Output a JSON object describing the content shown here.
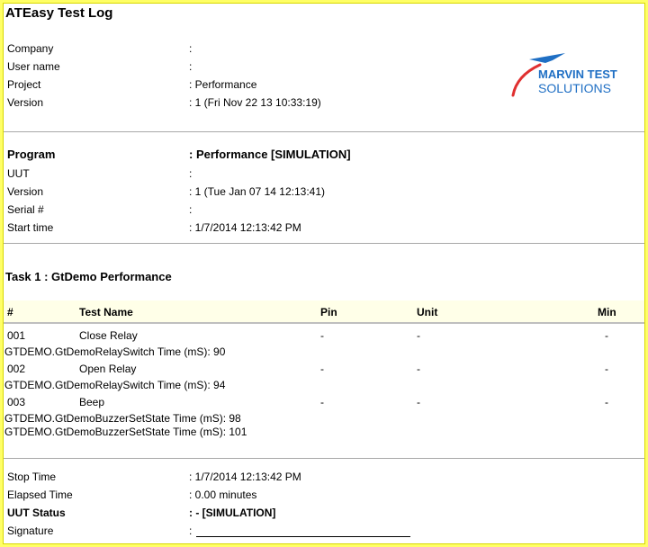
{
  "title": "ATEasy Test Log",
  "logo": {
    "line1": "MARVIN TEST",
    "line2": "SOLUTIONS",
    "colors": {
      "blue": "#1f6fc4",
      "red": "#e03030"
    }
  },
  "header_info": [
    {
      "label": "Company",
      "value": ":"
    },
    {
      "label": "User name",
      "value": ":"
    },
    {
      "label": "Project",
      "value": ": Performance"
    },
    {
      "label": "Version",
      "value": ": 1 (Fri Nov 22 13 10:33:19)"
    }
  ],
  "program": {
    "label": "Program",
    "value": ": Performance [SIMULATION]",
    "fields": [
      {
        "label": "UUT",
        "value": ":"
      },
      {
        "label": "Version",
        "value": ": 1 (Tue Jan 07 14 12:13:41)"
      },
      {
        "label": "Serial #",
        "value": ":"
      },
      {
        "label": "Start time",
        "value": ": 1/7/2014 12:13:42 PM"
      }
    ]
  },
  "task": {
    "title": "Task 1 : GtDemo Performance",
    "columns": [
      "#",
      "Test Name",
      "Pin",
      "Unit",
      "Min"
    ],
    "rows": [
      {
        "num": "001",
        "name": "Close Relay",
        "pin": "-",
        "unit": "-",
        "min": "-",
        "details": [
          "GTDEMO.GtDemoRelaySwitch Time (mS): 90"
        ]
      },
      {
        "num": "002",
        "name": "Open Relay",
        "pin": "-",
        "unit": "-",
        "min": "-",
        "details": [
          "GTDEMO.GtDemoRelaySwitch Time (mS): 94"
        ]
      },
      {
        "num": "003",
        "name": "Beep",
        "pin": "-",
        "unit": "-",
        "min": "-",
        "details": [
          "GTDEMO.GtDemoBuzzerSetState Time (mS): 98",
          "GTDEMO.GtDemoBuzzerSetState Time (mS): 101"
        ]
      }
    ]
  },
  "footer_info": [
    {
      "label": "Stop Time",
      "value": ": 1/7/2014 12:13:42 PM",
      "bold": false
    },
    {
      "label": "Elapsed Time",
      "value": ": 0.00 minutes",
      "bold": false
    },
    {
      "label": "UUT Status",
      "value": ": - [SIMULATION]",
      "bold": true
    },
    {
      "label": "Signature",
      "value": ":",
      "bold": false
    }
  ]
}
